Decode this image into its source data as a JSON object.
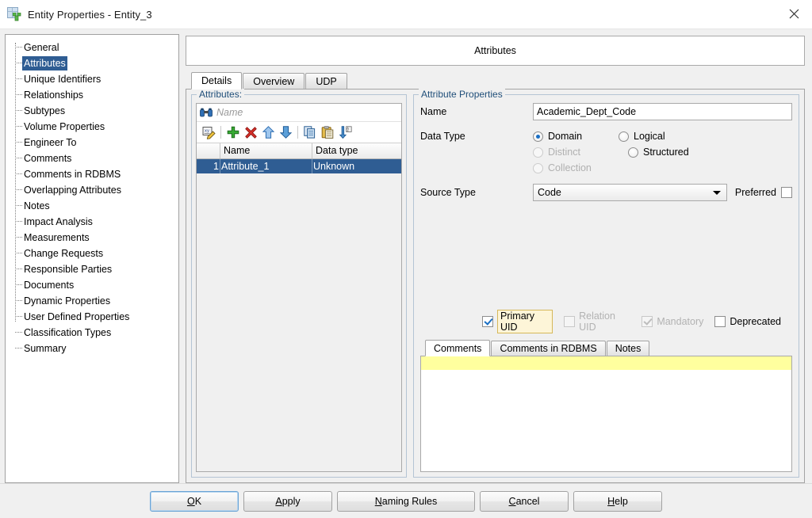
{
  "window": {
    "title": "Entity Properties - Entity_3",
    "app_icon": "entity-table-icon",
    "close_icon": "close-icon"
  },
  "sidebar": {
    "items": [
      {
        "label": "General",
        "selected": false
      },
      {
        "label": "Attributes",
        "selected": true
      },
      {
        "label": "Unique Identifiers",
        "selected": false
      },
      {
        "label": "Relationships",
        "selected": false
      },
      {
        "label": "Subtypes",
        "selected": false
      },
      {
        "label": "Volume Properties",
        "selected": false
      },
      {
        "label": "Engineer To",
        "selected": false
      },
      {
        "label": "Comments",
        "selected": false
      },
      {
        "label": "Comments in RDBMS",
        "selected": false
      },
      {
        "label": "Overlapping Attributes",
        "selected": false
      },
      {
        "label": "Notes",
        "selected": false
      },
      {
        "label": "Impact Analysis",
        "selected": false
      },
      {
        "label": "Measurements",
        "selected": false
      },
      {
        "label": "Change Requests",
        "selected": false
      },
      {
        "label": "Responsible Parties",
        "selected": false
      },
      {
        "label": "Documents",
        "selected": false
      },
      {
        "label": "Dynamic Properties",
        "selected": false
      },
      {
        "label": "User Defined Properties",
        "selected": false
      },
      {
        "label": "Classification Types",
        "selected": false
      },
      {
        "label": "Summary",
        "selected": false
      }
    ]
  },
  "page": {
    "header_title": "Attributes",
    "tabs": [
      {
        "label": "Details",
        "active": true
      },
      {
        "label": "Overview",
        "active": false
      },
      {
        "label": "UDP",
        "active": false
      }
    ]
  },
  "attributes_panel": {
    "group_title": "Attributes:",
    "search": {
      "placeholder": "Name",
      "value": "",
      "icon": "binoculars-icon"
    },
    "toolbar": [
      {
        "name": "edit-attribute-icon",
        "title": "Edit"
      },
      {
        "name": "add-attribute-icon",
        "title": "Add"
      },
      {
        "name": "delete-attribute-icon",
        "title": "Delete"
      },
      {
        "name": "move-up-icon",
        "title": "Move Up"
      },
      {
        "name": "move-down-icon",
        "title": "Move Down"
      },
      {
        "name": "copy-icon",
        "title": "Copy"
      },
      {
        "name": "paste-icon",
        "title": "Paste"
      },
      {
        "name": "sort-az-icon",
        "title": "Sort"
      }
    ],
    "columns": [
      "",
      "Name",
      "Data type"
    ],
    "rows": [
      {
        "num": "1",
        "name": "Attribute_1",
        "data_type": "Unknown",
        "selected": true
      }
    ]
  },
  "properties_panel": {
    "group_title": "Attribute Properties",
    "name_label": "Name",
    "name_value": "Academic_Dept_Code",
    "data_type_label": "Data Type",
    "data_type_options": [
      {
        "label": "Domain",
        "checked": true,
        "disabled": false
      },
      {
        "label": "Logical",
        "checked": false,
        "disabled": false
      },
      {
        "label": "Distinct",
        "checked": false,
        "disabled": true
      },
      {
        "label": "Structured",
        "checked": false,
        "disabled": false
      },
      {
        "label": "Collection",
        "checked": false,
        "disabled": true
      }
    ],
    "source_type_label": "Source Type",
    "source_type_value": "Code",
    "preferred_label": "Preferred",
    "preferred_checked": false,
    "flags": [
      {
        "label": "Primary UID",
        "checked": true,
        "disabled": false,
        "focused": true
      },
      {
        "label": "Relation UID",
        "checked": false,
        "disabled": true,
        "focused": false
      },
      {
        "label": "Mandatory",
        "checked": true,
        "disabled": true,
        "focused": false
      },
      {
        "label": "Deprecated",
        "checked": false,
        "disabled": false,
        "focused": false
      }
    ],
    "comments_tabs": [
      {
        "label": "Comments",
        "active": true
      },
      {
        "label": "Comments in RDBMS",
        "active": false
      },
      {
        "label": "Notes",
        "active": false
      }
    ],
    "comments_value": ""
  },
  "footer": {
    "buttons": [
      {
        "label": "OK",
        "mnemonic": "O",
        "focused": true,
        "wide": false
      },
      {
        "label": "Apply",
        "mnemonic": "A",
        "focused": false,
        "wide": false
      },
      {
        "label": "Naming Rules",
        "mnemonic": "N",
        "focused": false,
        "wide": true
      },
      {
        "label": "Cancel",
        "mnemonic": "C",
        "focused": false,
        "wide": false
      },
      {
        "label": "Help",
        "mnemonic": "H",
        "focused": false,
        "wide": false
      }
    ]
  }
}
